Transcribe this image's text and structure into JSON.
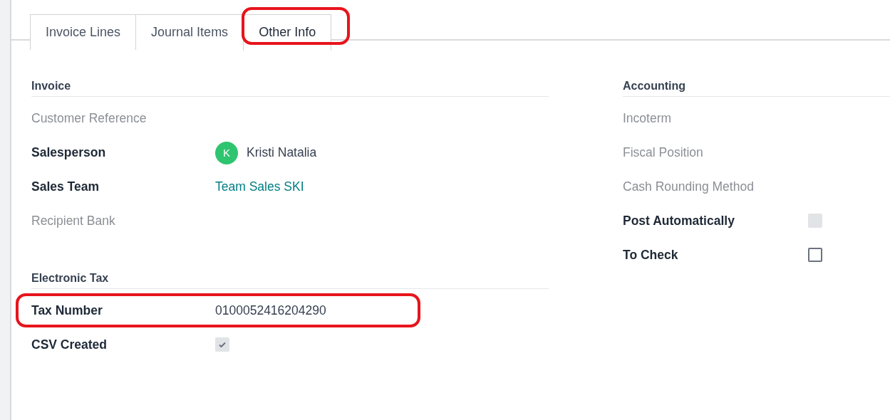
{
  "tabs": [
    {
      "label": "Invoice Lines",
      "selected": false,
      "highlighted": false
    },
    {
      "label": "Journal Items",
      "selected": false,
      "highlighted": false
    },
    {
      "label": "Other Info",
      "selected": true,
      "highlighted": true
    }
  ],
  "left_sections": [
    {
      "title": "Invoice",
      "fields": [
        {
          "kind": "empty",
          "label": "Customer Reference",
          "highlighted": false
        },
        {
          "kind": "avatar",
          "label": "Salesperson",
          "avatar_letter": "K",
          "color": "#2fc46f",
          "value": "Kristi Natalia",
          "highlighted": false
        },
        {
          "kind": "link",
          "label": "Sales Team",
          "value": "Team Sales SKI",
          "highlighted": false
        },
        {
          "kind": "empty",
          "label": "Recipient Bank",
          "highlighted": false
        }
      ]
    },
    {
      "title": "Electronic Tax",
      "fields": [
        {
          "kind": "text",
          "label": "Tax Number",
          "value": "0100052416204290",
          "highlighted": true
        },
        {
          "kind": "checkbox",
          "label": "CSV Created",
          "checked": true,
          "disabled": true,
          "highlighted": false
        }
      ]
    }
  ],
  "right_sections": [
    {
      "title": "Accounting",
      "fields": [
        {
          "kind": "empty",
          "label": "Incoterm",
          "highlighted": false
        },
        {
          "kind": "empty",
          "label": "Fiscal Position",
          "highlighted": false
        },
        {
          "kind": "empty",
          "label": "Cash Rounding Method",
          "highlighted": false
        },
        {
          "kind": "checkbox",
          "label": "Post Automatically",
          "checked": false,
          "disabled": true,
          "highlighted": false
        },
        {
          "kind": "checkbox",
          "label": "To Check",
          "checked": false,
          "disabled": false,
          "highlighted": false
        }
      ]
    }
  ]
}
